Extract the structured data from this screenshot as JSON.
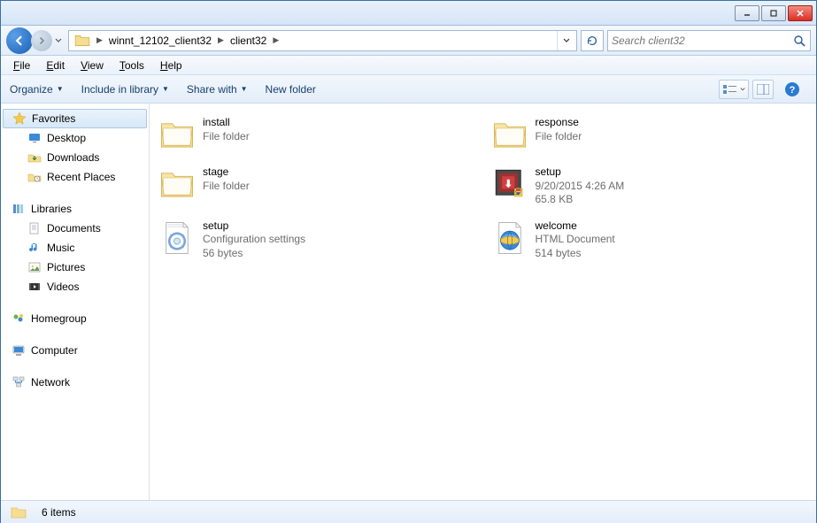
{
  "breadcrumb": {
    "seg1": "winnt_12102_client32",
    "seg2": "client32"
  },
  "search": {
    "placeholder": "Search client32"
  },
  "menu": {
    "file": "File",
    "edit": "Edit",
    "view": "View",
    "tools": "Tools",
    "help": "Help"
  },
  "toolbar": {
    "organize": "Organize",
    "include": "Include in library",
    "share": "Share with",
    "newfolder": "New folder"
  },
  "sidebar": {
    "favorites": {
      "label": "Favorites",
      "items": [
        "Desktop",
        "Downloads",
        "Recent Places"
      ]
    },
    "libraries": {
      "label": "Libraries",
      "items": [
        "Documents",
        "Music",
        "Pictures",
        "Videos"
      ]
    },
    "homegroup": {
      "label": "Homegroup"
    },
    "computer": {
      "label": "Computer"
    },
    "network": {
      "label": "Network"
    }
  },
  "files": [
    {
      "name": "install",
      "line2": "File folder",
      "line3": "",
      "icon": "folder"
    },
    {
      "name": "response",
      "line2": "File folder",
      "line3": "",
      "icon": "folder"
    },
    {
      "name": "stage",
      "line2": "File folder",
      "line3": "",
      "icon": "folder"
    },
    {
      "name": "setup",
      "line2": "9/20/2015 4:26 AM",
      "line3": "65.8 KB",
      "icon": "exe"
    },
    {
      "name": "setup",
      "line2": "Configuration settings",
      "line3": "56 bytes",
      "icon": "ini"
    },
    {
      "name": "welcome",
      "line2": "HTML Document",
      "line3": "514 bytes",
      "icon": "html"
    }
  ],
  "status": {
    "count": "6 items"
  }
}
